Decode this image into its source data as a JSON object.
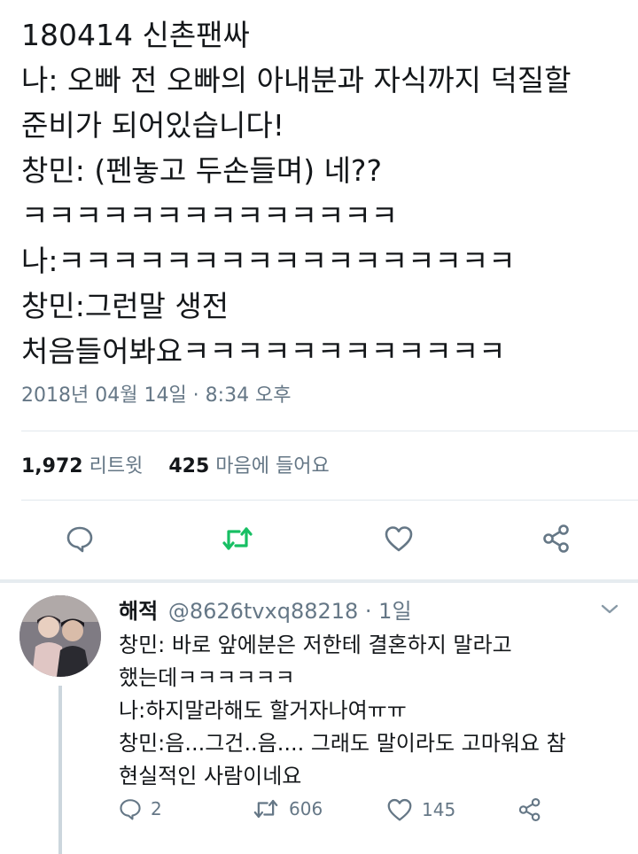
{
  "tweet": {
    "lines": [
      "180414 신촌팬싸",
      "나: 오빠 전 오빠의 아내분과 자식까지 덕질할",
      "준비가 되어있습니다!",
      "창민: (펜놓고 두손들며) 네??",
      "ㅋㅋㅋㅋㅋㅋㅋㅋㅋㅋㅋㅋㅋㅋ",
      "나:ㅋㅋㅋㅋㅋㅋㅋㅋㅋㅋㅋㅋㅋㅋㅋㅋㅋ",
      "창민:그런말 생전",
      "처음들어봐요ㅋㅋㅋㅋㅋㅋㅋㅋㅋㅋㅋㅋ"
    ],
    "timestamp": "2018년 04월 14일 · 8:34 오후",
    "retweet_count": "1,972",
    "retweet_label": "리트윗",
    "like_count": "425",
    "like_label": "마음에 들어요"
  },
  "icons": {
    "reply": "reply-icon",
    "retweet": "retweet-icon",
    "like": "heart-icon",
    "share": "share-icon",
    "chevron": "chevron-down-icon"
  },
  "colors": {
    "retweet_active": "#17bf63",
    "muted": "#657786",
    "text": "#14171a"
  },
  "reply": {
    "name": "해적",
    "handle": "@8626tvxq88218 · 1일",
    "lines": [
      "창민: 바로 앞에분은 저한테 결혼하지 말라고",
      "했는데ㅋㅋㅋㅋㅋㅋ",
      "나:하지말라해도 할거자나여ㅠㅠ",
      "창민:음...그건..음.... 그래도 말이라도 고마워요 참",
      "현실적인 사람이네요"
    ],
    "reply_count": "2",
    "retweet_count": "606",
    "like_count": "145"
  }
}
